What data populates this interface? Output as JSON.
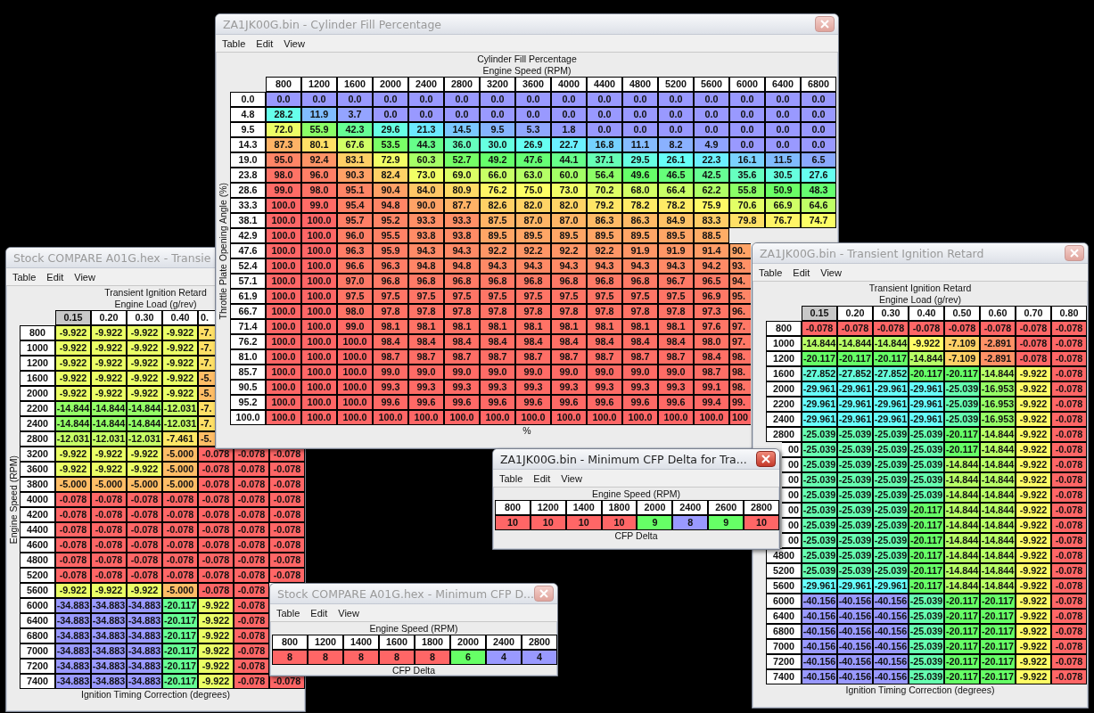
{
  "windows": [
    {
      "title": "Stock COMPARE A01G.hex - Transie",
      "active": false,
      "menu": [
        "Table",
        "Edit",
        "View"
      ],
      "table": {
        "title": "Transient Ignition Retard",
        "column_axis": "Engine Load (g/rev)",
        "row_axis": "Engine Speed (RPM)",
        "footer": "Ignition Timing Correction (degrees)",
        "columns": [
          {
            "label": "0.15",
            "selected": true
          },
          {
            "label": "0.20",
            "selected": false
          },
          {
            "label": "0.30",
            "selected": false
          },
          {
            "label": "0.40",
            "selected": false
          },
          {
            "label": "0.",
            "selected": false
          },
          null,
          null
        ],
        "rows": [
          {
            "label": "800",
            "cells": [
              "-9.922",
              "-9.922",
              "-9.922",
              "-9.922",
              "-7.",
              null,
              null
            ]
          },
          {
            "label": "1000",
            "cells": [
              "-9.922",
              "-9.922",
              "-9.922",
              "-9.922",
              "-7.",
              null,
              null
            ]
          },
          {
            "label": "1200",
            "cells": [
              "-9.922",
              "-9.922",
              "-9.922",
              "-9.922",
              "-7.",
              null,
              null
            ]
          },
          {
            "label": "1600",
            "cells": [
              "-9.922",
              "-9.922",
              "-9.922",
              "-9.922",
              "-5.",
              null,
              null
            ]
          },
          {
            "label": "2000",
            "cells": [
              "-9.922",
              "-9.922",
              "-9.922",
              "-9.922",
              "-5.",
              null,
              null
            ]
          },
          {
            "label": "2200",
            "cells": [
              "-14.844",
              "-14.844",
              "-14.844",
              "-12.031",
              "-7.",
              null,
              null
            ]
          },
          {
            "label": "2400",
            "cells": [
              "-14.844",
              "-14.844",
              "-14.844",
              "-12.031",
              "-7.",
              null,
              null
            ]
          },
          {
            "label": "2800",
            "cells": [
              "-12.031",
              "-12.031",
              "-12.031",
              "-7.461",
              "-5.",
              null,
              null
            ]
          },
          {
            "label": "3200",
            "cells": [
              "-9.922",
              "-9.922",
              "-9.922",
              "-5.000",
              "-0.078",
              "-0.078",
              "-0.078"
            ]
          },
          {
            "label": "3600",
            "cells": [
              "-9.922",
              "-9.922",
              "-9.922",
              "-5.000",
              "-0.078",
              "-0.078",
              "-0.078"
            ]
          },
          {
            "label": "3800",
            "cells": [
              "-5.000",
              "-5.000",
              "-5.000",
              "-5.000",
              "-0.078",
              "-0.078",
              "-0.078"
            ]
          },
          {
            "label": "4000",
            "cells": [
              "-0.078",
              "-0.078",
              "-0.078",
              "-0.078",
              "-0.078",
              "-0.078",
              "-0.078"
            ]
          },
          {
            "label": "4200",
            "cells": [
              "-0.078",
              "-0.078",
              "-0.078",
              "-0.078",
              "-0.078",
              "-0.078",
              "-0.078"
            ]
          },
          {
            "label": "4400",
            "cells": [
              "-0.078",
              "-0.078",
              "-0.078",
              "-0.078",
              "-0.078",
              "-0.078",
              "-0.078"
            ]
          },
          {
            "label": "4600",
            "cells": [
              "-0.078",
              "-0.078",
              "-0.078",
              "-0.078",
              "-0.078",
              "-0.078",
              "-0.078"
            ]
          },
          {
            "label": "4800",
            "cells": [
              "-0.078",
              "-0.078",
              "-0.078",
              "-0.078",
              "-0.078",
              "-0.078",
              "-0.078"
            ]
          },
          {
            "label": "5200",
            "cells": [
              "-0.078",
              "-0.078",
              "-0.078",
              "-0.078",
              "-0.078",
              "-0.078",
              "-0.078"
            ]
          },
          {
            "label": "5600",
            "cells": [
              "-9.922",
              "-9.922",
              "-9.922",
              "-5.000",
              "-0.078",
              "-0.078",
              null
            ]
          },
          {
            "label": "6000",
            "cells": [
              "-34.883",
              "-34.883",
              "-34.883",
              "-20.117",
              "-9.922",
              "-0.078",
              null
            ]
          },
          {
            "label": "6400",
            "cells": [
              "-34.883",
              "-34.883",
              "-34.883",
              "-20.117",
              "-9.922",
              "-0.078",
              null
            ]
          },
          {
            "label": "6800",
            "cells": [
              "-34.883",
              "-34.883",
              "-34.883",
              "-20.117",
              "-9.922",
              "-0.078",
              null
            ]
          },
          {
            "label": "7000",
            "cells": [
              "-34.883",
              "-34.883",
              "-34.883",
              "-20.117",
              "-9.922",
              "-0.078",
              null
            ]
          },
          {
            "label": "7200",
            "cells": [
              "-34.883",
              "-34.883",
              "-34.883",
              "-20.117",
              "-9.922",
              "-0.078",
              null
            ]
          },
          {
            "label": "7400",
            "cells": [
              "-34.883",
              "-34.883",
              "-34.883",
              "-20.117",
              "-9.922",
              "-0.078",
              "-0.078"
            ]
          }
        ]
      }
    },
    {
      "title": "ZA1JK00G.bin - Cylinder Fill Percentage",
      "active": false,
      "menu": [
        "Table",
        "Edit",
        "View"
      ],
      "table": {
        "title": "Cylinder Fill Percentage",
        "column_axis": "Engine Speed (RPM)",
        "row_axis": "Throttle Plate Opening Angle (%)",
        "footer": "%",
        "columns": [
          {
            "label": "800",
            "selected": false
          },
          {
            "label": "1200",
            "selected": false
          },
          {
            "label": "1600",
            "selected": false
          },
          {
            "label": "2000",
            "selected": false
          },
          {
            "label": "2400",
            "selected": false
          },
          {
            "label": "2800",
            "selected": false
          },
          {
            "label": "3200",
            "selected": false
          },
          {
            "label": "3600",
            "selected": false
          },
          {
            "label": "4000",
            "selected": false
          },
          {
            "label": "4400",
            "selected": false
          },
          {
            "label": "4800",
            "selected": false
          },
          {
            "label": "5200",
            "selected": false
          },
          {
            "label": "5600",
            "selected": false
          },
          {
            "label": "6000",
            "selected": false
          },
          {
            "label": "6400",
            "selected": false
          },
          {
            "label": "6800",
            "selected": false
          }
        ],
        "rows": [
          {
            "label": "0.0",
            "cells": [
              "0.0",
              "0.0",
              "0.0",
              "0.0",
              "0.0",
              "0.0",
              "0.0",
              "0.0",
              "0.0",
              "0.0",
              "0.0",
              "0.0",
              "0.0",
              "0.0",
              "0.0",
              "0.0"
            ]
          },
          {
            "label": "4.8",
            "cells": [
              "28.2",
              "11.9",
              "3.7",
              "0.0",
              "0.0",
              "0.0",
              "0.0",
              "0.0",
              "0.0",
              "0.0",
              "0.0",
              "0.0",
              "0.0",
              "0.0",
              "0.0",
              "0.0"
            ]
          },
          {
            "label": "9.5",
            "cells": [
              "72.0",
              "55.9",
              "42.3",
              "29.6",
              "21.3",
              "14.5",
              "9.5",
              "5.3",
              "1.8",
              "0.0",
              "0.0",
              "0.0",
              "0.0",
              "0.0",
              "0.0",
              "0.0"
            ]
          },
          {
            "label": "14.3",
            "cells": [
              "87.3",
              "80.1",
              "67.6",
              "53.5",
              "44.3",
              "36.0",
              "30.0",
              "26.9",
              "22.7",
              "16.8",
              "11.1",
              "8.2",
              "4.9",
              "0.0",
              "0.0",
              "0.0"
            ]
          },
          {
            "label": "19.0",
            "cells": [
              "95.0",
              "92.4",
              "83.1",
              "72.9",
              "60.3",
              "52.7",
              "49.2",
              "47.6",
              "44.1",
              "37.1",
              "29.5",
              "26.1",
              "22.3",
              "16.1",
              "11.5",
              "6.5"
            ]
          },
          {
            "label": "23.8",
            "cells": [
              "98.0",
              "96.0",
              "90.3",
              "82.4",
              "73.0",
              "69.0",
              "66.0",
              "63.0",
              "60.0",
              "56.4",
              "49.6",
              "46.5",
              "42.5",
              "35.6",
              "30.5",
              "27.6"
            ]
          },
          {
            "label": "28.6",
            "cells": [
              "99.0",
              "98.0",
              "95.1",
              "90.4",
              "84.0",
              "80.9",
              "76.2",
              "75.0",
              "73.0",
              "70.2",
              "68.0",
              "66.4",
              "62.2",
              "55.8",
              "50.9",
              "48.3"
            ]
          },
          {
            "label": "33.3",
            "cells": [
              "100.0",
              "99.0",
              "95.4",
              "94.8",
              "90.0",
              "87.7",
              "82.6",
              "82.0",
              "82.0",
              "79.2",
              "78.2",
              "78.2",
              "75.9",
              "70.6",
              "66.9",
              "64.6"
            ]
          },
          {
            "label": "38.1",
            "cells": [
              "100.0",
              "100.0",
              "95.7",
              "95.2",
              "93.3",
              "93.3",
              "87.5",
              "87.0",
              "87.0",
              "86.3",
              "86.3",
              "84.9",
              "83.3",
              "79.8",
              "76.7",
              "74.7"
            ]
          },
          {
            "label": "42.9",
            "cells": [
              "100.0",
              "100.0",
              "96.0",
              "95.5",
              "93.8",
              "93.8",
              "89.5",
              "89.5",
              "89.5",
              "89.5",
              "89.5",
              "89.5",
              "88.5",
              null,
              null,
              null
            ]
          },
          {
            "label": "47.6",
            "cells": [
              "100.0",
              "100.0",
              "96.3",
              "95.9",
              "94.3",
              "94.3",
              "92.2",
              "92.2",
              "92.2",
              "92.2",
              "91.9",
              "91.9",
              "91.4",
              "90.",
              null,
              null
            ]
          },
          {
            "label": "52.4",
            "cells": [
              "100.0",
              "100.0",
              "96.6",
              "96.3",
              "94.8",
              "94.8",
              "94.3",
              "94.3",
              "94.3",
              "94.3",
              "94.3",
              "94.3",
              "94.2",
              "93.",
              null,
              null
            ]
          },
          {
            "label": "57.1",
            "cells": [
              "100.0",
              "100.0",
              "97.0",
              "96.8",
              "96.8",
              "96.8",
              "96.8",
              "96.8",
              "96.8",
              "96.8",
              "96.8",
              "96.7",
              "96.5",
              "94.",
              null,
              null
            ]
          },
          {
            "label": "61.9",
            "cells": [
              "100.0",
              "100.0",
              "97.5",
              "97.5",
              "97.5",
              "97.5",
              "97.5",
              "97.5",
              "97.5",
              "97.5",
              "97.5",
              "97.5",
              "96.9",
              "95.",
              null,
              null
            ]
          },
          {
            "label": "66.7",
            "cells": [
              "100.0",
              "100.0",
              "98.0",
              "97.8",
              "97.8",
              "97.8",
              "97.8",
              "97.8",
              "97.8",
              "97.8",
              "97.8",
              "97.8",
              "97.3",
              "96.",
              null,
              null
            ]
          },
          {
            "label": "71.4",
            "cells": [
              "100.0",
              "100.0",
              "99.0",
              "98.1",
              "98.1",
              "98.1",
              "98.1",
              "98.1",
              "98.1",
              "98.1",
              "98.1",
              "98.1",
              "97.6",
              "97.",
              null,
              null
            ]
          },
          {
            "label": "76.2",
            "cells": [
              "100.0",
              "100.0",
              "100.0",
              "98.4",
              "98.4",
              "98.4",
              "98.4",
              "98.4",
              "98.4",
              "98.4",
              "98.4",
              "98.4",
              "98.0",
              "97.",
              null,
              null
            ]
          },
          {
            "label": "81.0",
            "cells": [
              "100.0",
              "100.0",
              "100.0",
              "98.7",
              "98.7",
              "98.7",
              "98.7",
              "98.7",
              "98.7",
              "98.7",
              "98.7",
              "98.7",
              "98.4",
              "98.",
              null,
              null
            ]
          },
          {
            "label": "85.7",
            "cells": [
              "100.0",
              "100.0",
              "100.0",
              "99.0",
              "99.0",
              "99.0",
              "99.0",
              "99.0",
              "99.0",
              "99.0",
              "99.0",
              "99.0",
              "98.7",
              "98.",
              null,
              null
            ]
          },
          {
            "label": "90.5",
            "cells": [
              "100.0",
              "100.0",
              "100.0",
              "99.3",
              "99.3",
              "99.3",
              "99.3",
              "99.3",
              "99.3",
              "99.3",
              "99.3",
              "99.3",
              "99.1",
              "98.",
              null,
              null
            ]
          },
          {
            "label": "95.2",
            "cells": [
              "100.0",
              "100.0",
              "100.0",
              "99.6",
              "99.6",
              "99.6",
              "99.6",
              "99.6",
              "99.6",
              "99.6",
              "99.6",
              "99.6",
              "99.4",
              "99.",
              null,
              null
            ]
          },
          {
            "label": "100.0",
            "cells": [
              "100.0",
              "100.0",
              "100.0",
              "100.0",
              "100.0",
              "100.0",
              "100.0",
              "100.0",
              "100.0",
              "100.0",
              "100.0",
              "100.0",
              "100.0",
              "100",
              null,
              null
            ]
          }
        ]
      }
    },
    {
      "title": "ZA1JK00G.bin - Transient Ignition Retard",
      "active": false,
      "menu": [
        "Table",
        "Edit",
        "View"
      ],
      "table": {
        "title": "Transient Ignition Retard",
        "column_axis": "Engine Load (g/rev)",
        "footer": "Ignition Timing Correction (degrees)",
        "columns": [
          {
            "label": "0.15",
            "selected": true
          },
          {
            "label": "0.20",
            "selected": false
          },
          {
            "label": "0.30",
            "selected": false
          },
          {
            "label": "0.40",
            "selected": false
          },
          {
            "label": "0.50",
            "selected": false
          },
          {
            "label": "0.60",
            "selected": false
          },
          {
            "label": "0.70",
            "selected": false
          },
          {
            "label": "0.80",
            "selected": false
          }
        ],
        "rows": [
          {
            "label": "800",
            "cells": [
              "-0.078",
              "-0.078",
              "-0.078",
              "-0.078",
              "-0.078",
              "-0.078",
              "-0.078",
              "-0.078"
            ]
          },
          {
            "label": "1000",
            "cells": [
              "-14.844",
              "-14.844",
              "-14.844",
              "-9.922",
              "-7.109",
              "-2.891",
              "-0.078",
              "-0.078"
            ]
          },
          {
            "label": "1200",
            "cells": [
              "-20.117",
              "-20.117",
              "-20.117",
              "-14.844",
              "-7.109",
              "-2.891",
              "-0.078",
              "-0.078"
            ]
          },
          {
            "label": "1600",
            "cells": [
              "-27.852",
              "-27.852",
              "-27.852",
              "-20.117",
              "-20.117",
              "-14.844",
              "-9.922",
              "-0.078"
            ]
          },
          {
            "label": "2000",
            "cells": [
              "-29.961",
              "-29.961",
              "-29.961",
              "-29.961",
              "-25.039",
              "-16.953",
              "-9.922",
              "-0.078"
            ]
          },
          {
            "label": "2200",
            "cells": [
              "-29.961",
              "-29.961",
              "-29.961",
              "-29.961",
              "-25.039",
              "-16.953",
              "-9.922",
              "-0.078"
            ]
          },
          {
            "label": "2400",
            "cells": [
              "-29.961",
              "-29.961",
              "-29.961",
              "-29.961",
              "-25.039",
              "-16.953",
              "-9.922",
              "-0.078"
            ]
          },
          {
            "label": "2800",
            "cells": [
              "-25.039",
              "-25.039",
              "-25.039",
              "-25.039",
              "-20.117",
              "-14.844",
              "-9.922",
              "-0.078"
            ]
          },
          {
            "label": "00",
            "cells": [
              "-25.039",
              "-25.039",
              "-25.039",
              "-25.039",
              "-20.117",
              "-14.844",
              "-9.922",
              "-0.078"
            ]
          },
          {
            "label": "00",
            "cells": [
              "-25.039",
              "-25.039",
              "-25.039",
              "-25.039",
              "-14.844",
              "-14.844",
              "-9.922",
              "-0.078"
            ]
          },
          {
            "label": "00",
            "cells": [
              "-25.039",
              "-25.039",
              "-25.039",
              "-25.039",
              "-14.844",
              "-14.844",
              "-9.922",
              "-0.078"
            ]
          },
          {
            "label": "00",
            "cells": [
              "-25.039",
              "-25.039",
              "-25.039",
              "-25.039",
              "-14.844",
              "-14.844",
              "-9.922",
              "-0.078"
            ]
          },
          {
            "label": "00",
            "cells": [
              "-25.039",
              "-25.039",
              "-25.039",
              "-20.117",
              "-14.844",
              "-14.844",
              "-9.922",
              "-0.078"
            ]
          },
          {
            "label": "00",
            "cells": [
              "-25.039",
              "-25.039",
              "-25.039",
              "-20.117",
              "-14.844",
              "-14.844",
              "-9.922",
              "-0.078"
            ]
          },
          {
            "label": "00",
            "cells": [
              "-25.039",
              "-25.039",
              "-25.039",
              "-20.117",
              "-14.844",
              "-14.844",
              "-9.922",
              "-0.078"
            ]
          },
          {
            "label": "4800",
            "cells": [
              "-25.039",
              "-25.039",
              "-25.039",
              "-20.117",
              "-14.844",
              "-14.844",
              "-9.922",
              "-0.078"
            ]
          },
          {
            "label": "5200",
            "cells": [
              "-25.039",
              "-25.039",
              "-25.039",
              "-20.117",
              "-14.844",
              "-14.844",
              "-9.922",
              "-0.078"
            ]
          },
          {
            "label": "5600",
            "cells": [
              "-29.961",
              "-29.961",
              "-29.961",
              "-20.117",
              "-14.844",
              "-14.844",
              "-9.922",
              "-0.078"
            ]
          },
          {
            "label": "6000",
            "cells": [
              "-40.156",
              "-40.156",
              "-40.156",
              "-25.039",
              "-20.117",
              "-20.117",
              "-9.922",
              "-0.078"
            ]
          },
          {
            "label": "6400",
            "cells": [
              "-40.156",
              "-40.156",
              "-40.156",
              "-25.039",
              "-20.117",
              "-20.117",
              "-9.922",
              "-0.078"
            ]
          },
          {
            "label": "6800",
            "cells": [
              "-40.156",
              "-40.156",
              "-40.156",
              "-25.039",
              "-20.117",
              "-20.117",
              "-9.922",
              "-0.078"
            ]
          },
          {
            "label": "7000",
            "cells": [
              "-40.156",
              "-40.156",
              "-40.156",
              "-25.039",
              "-20.117",
              "-20.117",
              "-9.922",
              "-0.078"
            ]
          },
          {
            "label": "7200",
            "cells": [
              "-40.156",
              "-40.156",
              "-40.156",
              "-25.039",
              "-20.117",
              "-20.117",
              "-9.922",
              "-0.078"
            ]
          },
          {
            "label": "7400",
            "cells": [
              "-40.156",
              "-40.156",
              "-40.156",
              "-25.039",
              "-20.117",
              "-20.117",
              "-9.922",
              "-0.078"
            ]
          }
        ]
      }
    },
    {
      "title": "ZA1JK00G.bin - Minimum CFP Delta for Tra...",
      "active": true,
      "menu": [
        "Table",
        "Edit",
        "View"
      ],
      "table": {
        "column_axis": "Engine Speed (RPM)",
        "footer": "CFP Delta",
        "columns": [
          {
            "label": "800",
            "selected": false
          },
          {
            "label": "1200",
            "selected": false
          },
          {
            "label": "1400",
            "selected": false
          },
          {
            "label": "1800",
            "selected": false
          },
          {
            "label": "2000",
            "selected": false
          },
          {
            "label": "2400",
            "selected": false
          },
          {
            "label": "2600",
            "selected": false
          },
          {
            "label": "2800",
            "selected": false
          }
        ],
        "rows": [
          {
            "cells": [
              "10",
              "10",
              "10",
              "10",
              "9",
              "8",
              "9",
              "10"
            ]
          }
        ]
      }
    },
    {
      "title": "Stock COMPARE A01G.hex - Minimum CFP D...",
      "active": false,
      "menu": [
        "Table",
        "Edit",
        "View"
      ],
      "table": {
        "column_axis": "Engine Speed (RPM)",
        "footer": "CFP Delta",
        "columns": [
          {
            "label": "800",
            "selected": false
          },
          {
            "label": "1200",
            "selected": false
          },
          {
            "label": "1400",
            "selected": false
          },
          {
            "label": "1600",
            "selected": false
          },
          {
            "label": "1800",
            "selected": false
          },
          {
            "label": "2000",
            "selected": false
          },
          {
            "label": "2400",
            "selected": false
          },
          {
            "label": "2800",
            "selected": false
          }
        ],
        "rows": [
          {
            "cells": [
              "8",
              "8",
              "8",
              "8",
              "8",
              "6",
              "4",
              "4"
            ]
          }
        ]
      }
    }
  ]
}
